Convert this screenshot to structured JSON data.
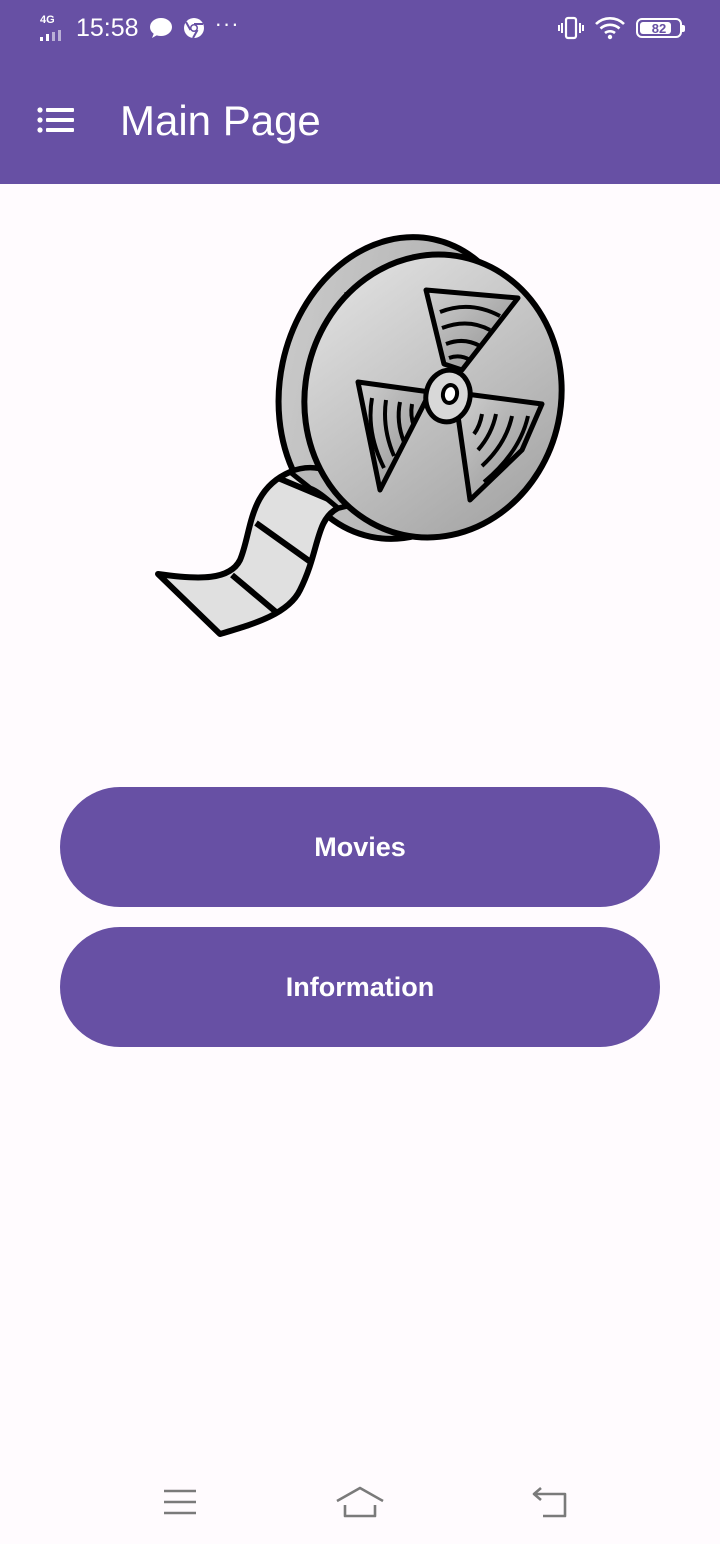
{
  "status_bar": {
    "network": "4G",
    "time": "15:58",
    "battery": "82",
    "battery_level_percent": 82,
    "icons": [
      "signal-icon",
      "chat-bubble-icon",
      "chrome-icon",
      "more-icon",
      "vibrate-icon",
      "wifi-icon",
      "battery-icon"
    ]
  },
  "app_bar": {
    "title": "Main Page",
    "menu_icon": "list-menu-icon"
  },
  "illustration": {
    "icon": "film-reel-icon"
  },
  "buttons": {
    "movies": "Movies",
    "information": "Information"
  },
  "nav_bar": {
    "icons": [
      "menu-icon",
      "home-icon",
      "back-icon"
    ]
  },
  "colors": {
    "primary": "#6750a4",
    "background": "#fffbfe",
    "on_primary": "#ffffff",
    "nav_icon": "#7a7a7a"
  }
}
